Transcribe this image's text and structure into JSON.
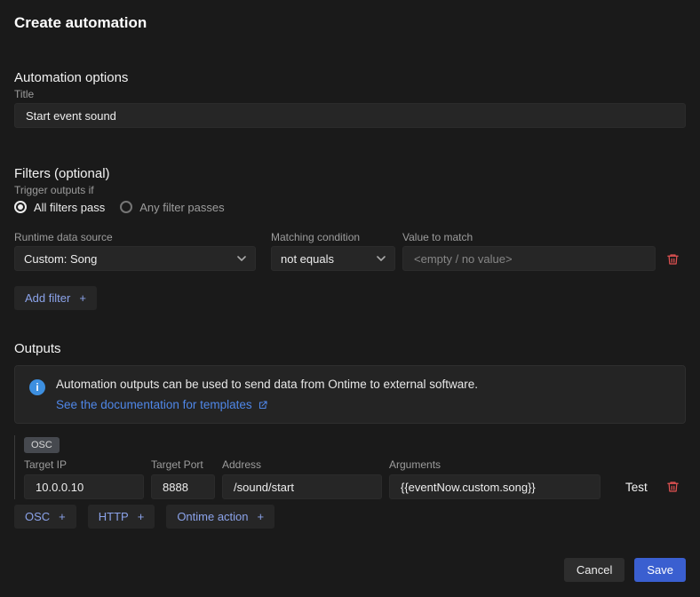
{
  "dialog": {
    "title": "Create automation"
  },
  "automation_options": {
    "heading": "Automation options",
    "title_label": "Title",
    "title_value": "Start event sound"
  },
  "filters": {
    "heading": "Filters (optional)",
    "trigger_label": "Trigger outputs if",
    "radio_all": "All filters pass",
    "radio_any": "Any filter passes",
    "columns": {
      "source_label": "Runtime data source",
      "condition_label": "Matching condition",
      "value_label": "Value to match"
    },
    "row": {
      "source_value": "Custom: Song",
      "condition_value": "not equals",
      "value_placeholder": "<empty / no value>"
    },
    "add_filter": {
      "label": "Add filter",
      "plus": "+"
    }
  },
  "outputs": {
    "heading": "Outputs",
    "info_text": "Automation outputs can be used to send data from Ontime to external software.",
    "info_link": "See the documentation for templates",
    "osc_badge": "OSC",
    "fields": {
      "target_ip_label": "Target IP",
      "target_ip_value": "10.0.0.10",
      "target_port_label": "Target Port",
      "target_port_value": "8888",
      "address_label": "Address",
      "address_value": "/sound/start",
      "arguments_label": "Arguments",
      "arguments_value": "{{eventNow.custom.song}}"
    },
    "test_label": "Test",
    "add_buttons": [
      {
        "label": "OSC",
        "plus": "+"
      },
      {
        "label": "HTTP",
        "plus": "+"
      },
      {
        "label": "Ontime action",
        "plus": "+"
      }
    ]
  },
  "footer": {
    "cancel_label": "Cancel",
    "save_label": "Save"
  },
  "icons": {
    "info": "i"
  },
  "colors": {
    "background": "#1a1a1a",
    "field_background": "#262626",
    "accent_blue": "#3a5fd0",
    "link_blue": "#4f87e8",
    "ghost_button_blue": "#8ba3ea",
    "danger_red": "#e05252"
  }
}
